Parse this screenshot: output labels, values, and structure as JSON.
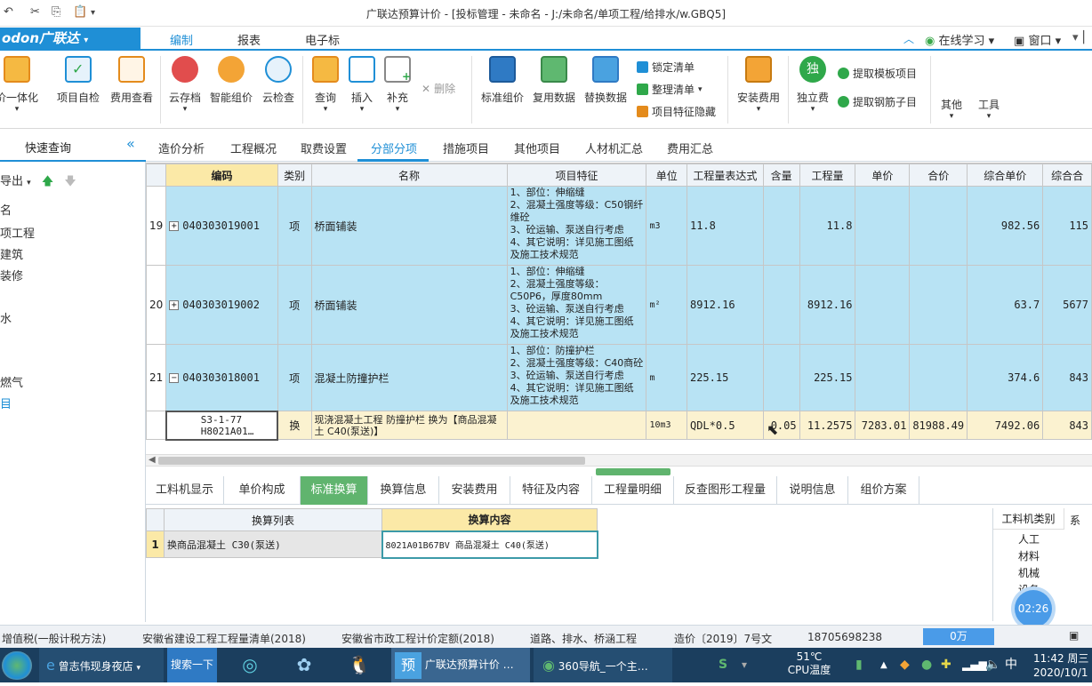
{
  "window": {
    "title": "广联达预算计价 - [投标管理 - 未命名 - J:/未命名/单项工程/给排水/w.GBQ5]"
  },
  "menubar": {
    "logo": "odon广联达",
    "items": [
      "编制",
      "报表",
      "电子标"
    ],
    "online": "在线学习",
    "window_menu": "窗口"
  },
  "ribbon": {
    "buttons": [
      {
        "label": "价一体化",
        "icon": "integrate-icon"
      },
      {
        "label": "项目自检",
        "icon": "check-icon"
      },
      {
        "label": "费用查看",
        "icon": "view-cost-icon"
      },
      {
        "label": "云存档",
        "icon": "cloud-save-icon"
      },
      {
        "label": "智能组价",
        "icon": "smart-price-icon"
      },
      {
        "label": "云检查",
        "icon": "cloud-check-icon"
      },
      {
        "label": "查询",
        "icon": "query-icon"
      },
      {
        "label": "插入",
        "icon": "insert-icon"
      },
      {
        "label": "补充",
        "icon": "supplement-icon"
      },
      {
        "label": "标准组价",
        "icon": "standard-price-icon"
      },
      {
        "label": "复用数据",
        "icon": "reuse-data-icon"
      },
      {
        "label": "替换数据",
        "icon": "replace-data-icon"
      },
      {
        "label": "安装费用",
        "icon": "install-cost-icon"
      },
      {
        "label": "独立费",
        "icon": "independent-fee-icon"
      },
      {
        "label": "其他",
        "icon": "other-icon"
      },
      {
        "label": "工具",
        "icon": "tools-icon"
      }
    ],
    "delete": "删除",
    "lock": "锁定清单",
    "organize": "整理清单",
    "hide_feature": "项目特征隐藏",
    "extract_template": "提取模板项目",
    "extract_rebar": "提取钢筋子目"
  },
  "left_panel": {
    "quick_query": "快速查询",
    "export": "导出",
    "items": [
      "名",
      "项工程",
      "建筑",
      "装修",
      "水",
      "燃气",
      "目"
    ]
  },
  "tabs": [
    "造价分析",
    "工程概况",
    "取费设置",
    "分部分项",
    "措施项目",
    "其他项目",
    "人材机汇总",
    "费用汇总"
  ],
  "grid": {
    "headers": [
      "编码",
      "类别",
      "名称",
      "项目特征",
      "单位",
      "工程量表达式",
      "含量",
      "工程量",
      "单价",
      "合价",
      "综合单价",
      "综合合"
    ],
    "rows": [
      {
        "no": "19",
        "code": "040303019001",
        "type": "项",
        "name": "桥面铺装",
        "feature": "1、部位：伸缩缝\n2、混凝土强度等级：C50钢纤维砼\n3、砼运输、泵送自行考虑\n4、其它说明：详见施工图纸及施工技术规范",
        "unit": "m3",
        "expr": "11.8",
        "content": "",
        "qty": "11.8",
        "price": "",
        "total": "",
        "comp_price": "982.56",
        "comp_total": "115"
      },
      {
        "no": "20",
        "code": "040303019002",
        "type": "项",
        "name": "桥面铺装",
        "feature": "1、部位：伸缩缝\n2、混凝土强度等级：C50P6，厚度80mm\n3、砼运输、泵送自行考虑\n4、其它说明：详见施工图纸及施工技术规范",
        "unit": "m²",
        "expr": "8912.16",
        "content": "",
        "qty": "8912.16",
        "price": "",
        "total": "",
        "comp_price": "63.7",
        "comp_total": "5677"
      },
      {
        "no": "21",
        "code": "040303018001",
        "type": "项",
        "name": "混凝土防撞护栏",
        "feature": "1、部位：防撞护栏\n2、混凝土强度等级：C40商砼\n3、砼运输、泵送自行考虑\n4、其它说明：详见施工图纸及施工技术规范",
        "unit": "m",
        "expr": "225.15",
        "content": "",
        "qty": "225.15",
        "price": "",
        "total": "",
        "comp_price": "374.6",
        "comp_total": "843"
      },
      {
        "no": "",
        "code": "S3-1-77 H8021A01…",
        "type": "换",
        "name": "现浇混凝土工程 防撞护栏  换为【商品混凝土 C40(泵送)】",
        "feature": "",
        "unit": "10m3",
        "expr": "QDL*0.5",
        "content": "0.05",
        "qty": "11.2575",
        "price": "7283.01",
        "total": "81988.49",
        "comp_price": "7492.06",
        "comp_total": "843"
      }
    ]
  },
  "bottom_tabs": [
    "工料机显示",
    "单价构成",
    "标准换算",
    "换算信息",
    "安装费用",
    "特征及内容",
    "工程量明细",
    "反查图形工程量",
    "说明信息",
    "组价方案"
  ],
  "conversion": {
    "col_list": "换算列表",
    "col_content": "换算内容",
    "rows": [
      {
        "no": "1",
        "list": "换商品混凝土 C30(泵送)",
        "content": "8021A01B67BV  商品混凝土 C40(泵送)"
      }
    ]
  },
  "side_table": {
    "header": "工料机类别",
    "header2": "系",
    "items": [
      "人工",
      "材料",
      "机械",
      "设备"
    ]
  },
  "timer": "02:26",
  "status": {
    "items": [
      "增值税(一般计税方法)",
      "安徽省建设工程工程量清单(2018)",
      "安徽省市政工程计价定额(2018)",
      "道路、排水、桥涵工程",
      "造价〔2019〕7号文",
      "18705698238"
    ],
    "value": "0万"
  },
  "taskbar": {
    "items": [
      "曾志伟现身夜店",
      "搜索一下",
      "广联达预算计价 …",
      "360导航_一个主…"
    ],
    "temp": "51℃",
    "temp_label": "CPU温度",
    "time": "11:42 周三",
    "date": "2020/10/1"
  },
  "colors": {
    "accent": "#1f8fd6",
    "selected_row": "#b8e3f4",
    "active_tab": "#60b46e",
    "header_sel": "#fbe9a7"
  }
}
